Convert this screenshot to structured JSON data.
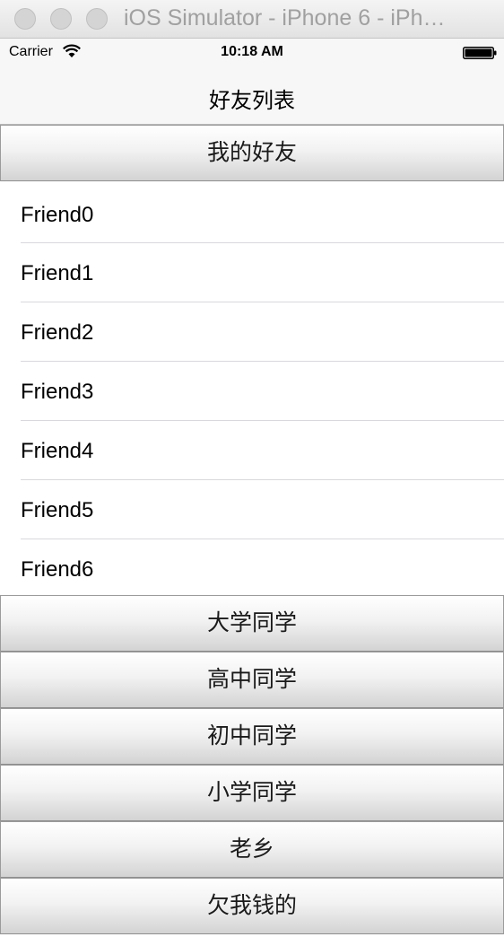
{
  "window": {
    "title": "iOS Simulator - iPhone 6 - iPh…"
  },
  "status_bar": {
    "carrier": "Carrier",
    "time": "10:18 AM",
    "wifi_icon": "wifi-icon",
    "battery_icon": "battery-full-icon"
  },
  "nav": {
    "title": "好友列表"
  },
  "groups": [
    {
      "label": "我的好友",
      "expanded": true
    },
    {
      "label": "大学同学",
      "expanded": false
    },
    {
      "label": "高中同学",
      "expanded": false
    },
    {
      "label": "初中同学",
      "expanded": false
    },
    {
      "label": "小学同学",
      "expanded": false
    },
    {
      "label": "老乡",
      "expanded": false
    },
    {
      "label": "欠我钱的",
      "expanded": false
    }
  ],
  "friends": [
    {
      "label": "Friend0"
    },
    {
      "label": "Friend1"
    },
    {
      "label": "Friend2"
    },
    {
      "label": "Friend3"
    },
    {
      "label": "Friend4"
    },
    {
      "label": "Friend5"
    },
    {
      "label": "Friend6"
    }
  ]
}
